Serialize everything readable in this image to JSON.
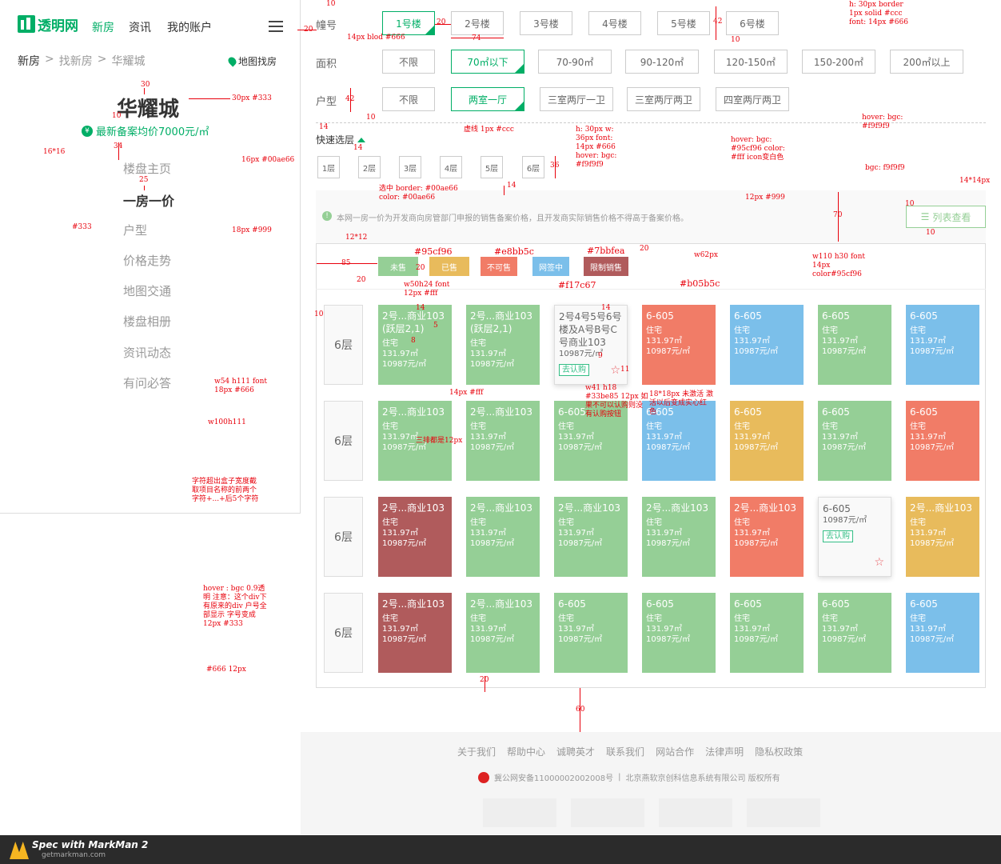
{
  "header": {
    "logo": "透明网",
    "nav": [
      "新房",
      "资讯",
      "我的账户"
    ]
  },
  "crumb": {
    "items": [
      "新房",
      ">",
      "找新房",
      ">",
      "华耀城"
    ],
    "map": "地图找房"
  },
  "project": {
    "title": "华耀城",
    "price": "最新备案均价7000元/㎡"
  },
  "menu": [
    "楼盘主页",
    "一房一价",
    "户型",
    "价格走势",
    "地图交通",
    "楼盘相册",
    "资讯动态",
    "有问必答"
  ],
  "filters": {
    "building": {
      "label": "幢号",
      "options": [
        "1号楼",
        "2号楼",
        "3号楼",
        "4号楼",
        "5号楼",
        "6号楼"
      ],
      "selected": 0
    },
    "area": {
      "label": "面积",
      "options": [
        "不限",
        "70㎡以下",
        "70-90㎡",
        "90-120㎡",
        "120-150㎡",
        "150-200㎡",
        "200㎡以上"
      ],
      "selected": 1
    },
    "type": {
      "label": "户型",
      "options": [
        "不限",
        "两室一厅",
        "三室两厅一卫",
        "三室两厅两卫",
        "四室两厅两卫"
      ],
      "selected": 1
    }
  },
  "quick": {
    "label": "快速选层",
    "floors": [
      "1层",
      "2层",
      "3层",
      "4层",
      "5层",
      "6层"
    ]
  },
  "notice": "本网一房一价为开发商向房管部门申报的销售备案价格，且开发商实际销售价格不得高于备案价格。",
  "list_button": "列表查看",
  "legend": [
    {
      "label": "未售",
      "color": "#95cf96"
    },
    {
      "label": "已售",
      "color": "#e8bb5c"
    },
    {
      "label": "不可售",
      "color": "#f17c67"
    },
    {
      "label": "网签中",
      "color": "#7bbfea"
    },
    {
      "label": "限制销售",
      "color": "#b05b5c"
    }
  ],
  "units": {
    "type": "住宅",
    "area": "131.97㎡",
    "price": "10987元/㎡",
    "subscribe": "去认购"
  },
  "rows": [
    {
      "floor": "6层",
      "cells": [
        {
          "name": "2号...商业103",
          "sub": "(跃层2,1)",
          "status": "未售"
        },
        {
          "name": "2号...商业103",
          "sub": "(跃层2,1)",
          "status": "未售"
        },
        {
          "name": "2号4号5号6号楼及A号B号C号商业103",
          "sub": "",
          "status": "hover"
        },
        {
          "name": "6-605",
          "sub": "",
          "status": "不可售"
        },
        {
          "name": "6-605",
          "sub": "",
          "status": "网签中"
        },
        {
          "name": "6-605",
          "sub": "",
          "status": "未售"
        },
        {
          "name": "6-605",
          "sub": "",
          "status": "网签中"
        }
      ]
    },
    {
      "floor": "6层",
      "cells": [
        {
          "name": "2号...商业103",
          "sub": "",
          "status": "未售"
        },
        {
          "name": "2号...商业103",
          "sub": "",
          "status": "未售"
        },
        {
          "name": "6-605",
          "sub": "",
          "status": "未售"
        },
        {
          "name": "6-605",
          "sub": "",
          "status": "网签中"
        },
        {
          "name": "6-605",
          "sub": "",
          "status": "已售"
        },
        {
          "name": "6-605",
          "sub": "",
          "status": "未售"
        },
        {
          "name": "6-605",
          "sub": "",
          "status": "不可售"
        }
      ]
    },
    {
      "floor": "6层",
      "cells": [
        {
          "name": "2号...商业103",
          "sub": "",
          "status": "限制销售"
        },
        {
          "name": "2号...商业103",
          "sub": "",
          "status": "未售"
        },
        {
          "name": "2号...商业103",
          "sub": "",
          "status": "未售"
        },
        {
          "name": "2号...商业103",
          "sub": "",
          "status": "未售"
        },
        {
          "name": "2号...商业103",
          "sub": "",
          "status": "不可售"
        },
        {
          "name": "6-605",
          "sub": "",
          "status": "hover"
        },
        {
          "name": "2号...商业103",
          "sub": "",
          "status": "已售"
        }
      ]
    },
    {
      "floor": "6层",
      "cells": [
        {
          "name": "2号...商业103",
          "sub": "",
          "status": "限制销售"
        },
        {
          "name": "2号...商业103",
          "sub": "",
          "status": "未售"
        },
        {
          "name": "6-605",
          "sub": "",
          "status": "未售"
        },
        {
          "name": "6-605",
          "sub": "",
          "status": "未售"
        },
        {
          "name": "6-605",
          "sub": "",
          "status": "未售"
        },
        {
          "name": "6-605",
          "sub": "",
          "status": "未售"
        },
        {
          "name": "6-605",
          "sub": "",
          "status": "网签中"
        }
      ]
    }
  ],
  "footer": {
    "links": [
      "关于我们",
      "帮助中心",
      "诚聘英才",
      "联系我们",
      "网站合作",
      "法律声明",
      "隐私权政策"
    ],
    "icp": "冀公网安备11000002002008号",
    "sep": "|",
    "company": "北京燕软京创科信息系统有限公司 版权所有"
  },
  "markman": {
    "title": "Spec with MarkMan 2",
    "url": "getmarkman.com"
  },
  "annotations": {
    "a1": "14px blod #666",
    "a2": "h: 30px border 1px solid #ccc font: 14px #666",
    "a3": "hover: bgc: #f9f9f9",
    "a4": "虚线 1px #ccc",
    "a5": "h: 30px w: 36px font: 14px #666 hover: bgc: #f9f9f9",
    "a6": "hover: bgc: #95cf96 color: #fff icon变白色",
    "a7": "bgc: f9f9f9",
    "a8": "14*14px",
    "a9": "12px #999",
    "a10": "选中 border: #00ae66 color: #00ae66",
    "a11": "w110 h30 font 14px color#95cf96",
    "a12": "w62px",
    "a13": "w50h24 font 12px #fff",
    "a14": "30px #333",
    "a15": "16px #00ae66",
    "a16": "16*16",
    "a17": "18px #999",
    "a18": "#333",
    "a19": "w54 h111 font 18px #666",
    "a20": "w100h111",
    "a21": "14px #fff",
    "a22": "三排都是12px",
    "a23": "字符超出盒子宽度截取项目名称的前两个字符+...+后5个字符",
    "a24": "hover : bgc 0.9透明 注意：这个div下有原来的div 户号全部显示 字号变成12px #333",
    "a25": "#666 12px",
    "a26": "w41 h18 #33be85 12px 如果不可以认购则没有认购按钮",
    "a27": "18*18px 未激活 激活以后变成实心红色",
    "a28": "12*12",
    "c1": "#95cf96",
    "c2": "#e8bb5c",
    "c3": "#7bbfea",
    "c4": "#f17c67",
    "c5": "#b05b5c",
    "n10": "10",
    "n20": "20",
    "n74": "74",
    "n42": "42",
    "n30": "30",
    "n34": "34",
    "n25": "25",
    "n14": "14",
    "n36": "36",
    "n70": "70",
    "n85": "85",
    "n8": "8",
    "n5": "5",
    "n9": "9",
    "n11": "11",
    "n60": "60"
  }
}
